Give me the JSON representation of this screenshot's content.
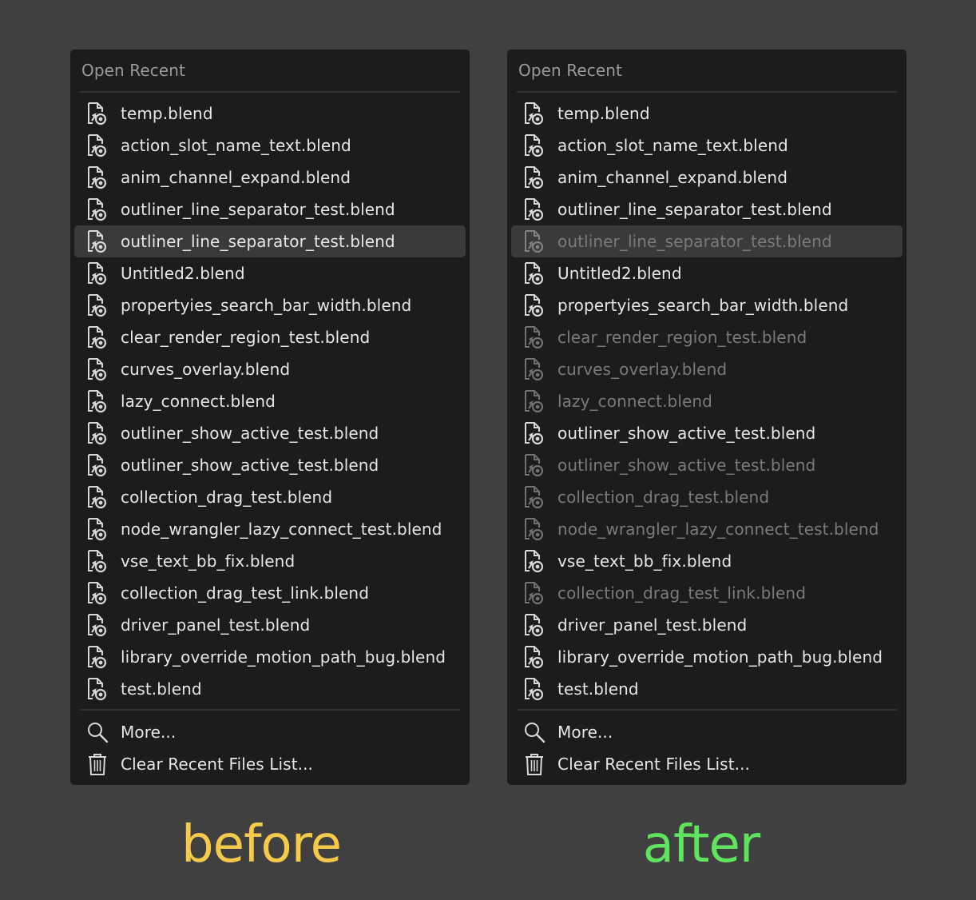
{
  "panels": {
    "before": {
      "title": "Open Recent",
      "items": [
        {
          "label": "temp.blend",
          "icon": "blend-file-icon",
          "dim": false,
          "highlight": false
        },
        {
          "label": "action_slot_name_text.blend",
          "icon": "blend-file-icon",
          "dim": false,
          "highlight": false
        },
        {
          "label": "anim_channel_expand.blend",
          "icon": "blend-file-icon",
          "dim": false,
          "highlight": false
        },
        {
          "label": "outliner_line_separator_test.blend",
          "icon": "blend-file-icon",
          "dim": false,
          "highlight": false
        },
        {
          "label": "outliner_line_separator_test.blend",
          "icon": "blend-file-icon",
          "dim": false,
          "highlight": true
        },
        {
          "label": "Untitled2.blend",
          "icon": "blend-file-icon",
          "dim": false,
          "highlight": false
        },
        {
          "label": "propertyies_search_bar_width.blend",
          "icon": "blend-file-icon",
          "dim": false,
          "highlight": false
        },
        {
          "label": "clear_render_region_test.blend",
          "icon": "blend-file-icon",
          "dim": false,
          "highlight": false
        },
        {
          "label": "curves_overlay.blend",
          "icon": "blend-file-icon",
          "dim": false,
          "highlight": false
        },
        {
          "label": "lazy_connect.blend",
          "icon": "blend-file-icon",
          "dim": false,
          "highlight": false
        },
        {
          "label": "outliner_show_active_test.blend",
          "icon": "blend-file-icon",
          "dim": false,
          "highlight": false
        },
        {
          "label": "outliner_show_active_test.blend",
          "icon": "blend-file-icon",
          "dim": false,
          "highlight": false
        },
        {
          "label": "collection_drag_test.blend",
          "icon": "blend-file-icon",
          "dim": false,
          "highlight": false
        },
        {
          "label": "node_wrangler_lazy_connect_test.blend",
          "icon": "blend-file-icon",
          "dim": false,
          "highlight": false
        },
        {
          "label": "vse_text_bb_fix.blend",
          "icon": "blend-file-icon",
          "dim": false,
          "highlight": false
        },
        {
          "label": "collection_drag_test_link.blend",
          "icon": "blend-file-icon",
          "dim": false,
          "highlight": false
        },
        {
          "label": "driver_panel_test.blend",
          "icon": "blend-file-icon",
          "dim": false,
          "highlight": false
        },
        {
          "label": "library_override_motion_path_bug.blend",
          "icon": "blend-file-icon",
          "dim": false,
          "highlight": false
        },
        {
          "label": "test.blend",
          "icon": "blend-file-icon",
          "dim": false,
          "highlight": false
        }
      ],
      "footer": [
        {
          "label": "More...",
          "icon": "search-icon"
        },
        {
          "label": "Clear Recent Files List...",
          "icon": "trash-icon"
        }
      ]
    },
    "after": {
      "title": "Open Recent",
      "items": [
        {
          "label": "temp.blend",
          "icon": "blend-file-icon",
          "dim": false,
          "highlight": false
        },
        {
          "label": "action_slot_name_text.blend",
          "icon": "blend-file-icon",
          "dim": false,
          "highlight": false
        },
        {
          "label": "anim_channel_expand.blend",
          "icon": "blend-file-icon",
          "dim": false,
          "highlight": false
        },
        {
          "label": "outliner_line_separator_test.blend",
          "icon": "blend-file-icon",
          "dim": false,
          "highlight": false
        },
        {
          "label": "outliner_line_separator_test.blend",
          "icon": "blend-file-icon",
          "dim": true,
          "highlight": true
        },
        {
          "label": "Untitled2.blend",
          "icon": "blend-file-icon",
          "dim": false,
          "highlight": false
        },
        {
          "label": "propertyies_search_bar_width.blend",
          "icon": "blend-file-icon",
          "dim": false,
          "highlight": false
        },
        {
          "label": "clear_render_region_test.blend",
          "icon": "blend-file-icon",
          "dim": true,
          "highlight": false
        },
        {
          "label": "curves_overlay.blend",
          "icon": "blend-file-icon",
          "dim": true,
          "highlight": false
        },
        {
          "label": "lazy_connect.blend",
          "icon": "blend-file-icon",
          "dim": true,
          "highlight": false
        },
        {
          "label": "outliner_show_active_test.blend",
          "icon": "blend-file-icon",
          "dim": false,
          "highlight": false
        },
        {
          "label": "outliner_show_active_test.blend",
          "icon": "blend-file-icon",
          "dim": true,
          "highlight": false
        },
        {
          "label": "collection_drag_test.blend",
          "icon": "blend-file-icon",
          "dim": true,
          "highlight": false
        },
        {
          "label": "node_wrangler_lazy_connect_test.blend",
          "icon": "blend-file-icon",
          "dim": true,
          "highlight": false
        },
        {
          "label": "vse_text_bb_fix.blend",
          "icon": "blend-file-icon",
          "dim": false,
          "highlight": false
        },
        {
          "label": "collection_drag_test_link.blend",
          "icon": "blend-file-icon",
          "dim": true,
          "highlight": false
        },
        {
          "label": "driver_panel_test.blend",
          "icon": "blend-file-icon",
          "dim": false,
          "highlight": false
        },
        {
          "label": "library_override_motion_path_bug.blend",
          "icon": "blend-file-icon",
          "dim": false,
          "highlight": false
        },
        {
          "label": "test.blend",
          "icon": "blend-file-icon",
          "dim": false,
          "highlight": false
        }
      ],
      "footer": [
        {
          "label": "More...",
          "icon": "search-icon"
        },
        {
          "label": "Clear Recent Files List...",
          "icon": "trash-icon"
        }
      ]
    }
  },
  "captions": {
    "before": "before",
    "after": "after"
  },
  "colors": {
    "background": "#404040",
    "panel": "#1c1c1c",
    "highlight": "#3a3a3a",
    "text": "#e6e6e6",
    "dim_text": "#7a7a7a",
    "before_caption": "#f5c94a",
    "after_caption": "#5ee45e"
  }
}
